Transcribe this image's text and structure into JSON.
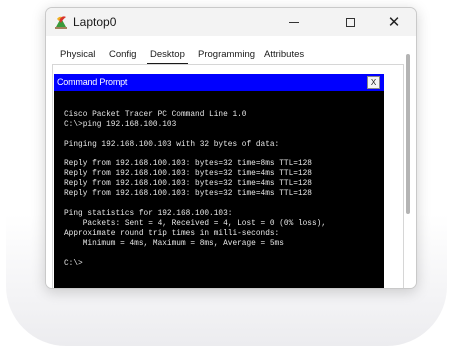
{
  "window": {
    "title": "Laptop0",
    "minimize_glyph": "—",
    "close_glyph": "✕"
  },
  "tabs": [
    {
      "label": "Physical"
    },
    {
      "label": "Config"
    },
    {
      "label": "Desktop",
      "active": true
    },
    {
      "label": "Programming"
    },
    {
      "label": "Attributes"
    }
  ],
  "command_prompt": {
    "title": "Command Prompt",
    "close_label": "X"
  },
  "terminal": {
    "lines": [
      "",
      "Cisco Packet Tracer PC Command Line 1.0",
      "C:\\>ping 192.168.100.103",
      "",
      "Pinging 192.168.100.103 with 32 bytes of data:",
      "",
      "Reply from 192.168.100.103: bytes=32 time=8ms TTL=128",
      "Reply from 192.168.100.103: bytes=32 time=4ms TTL=128",
      "Reply from 192.168.100.103: bytes=32 time=4ms TTL=128",
      "Reply from 192.168.100.103: bytes=32 time=4ms TTL=128",
      "",
      "Ping statistics for 192.168.100.103:",
      "    Packets: Sent = 4, Received = 4, Lost = 0 (0% loss),",
      "Approximate round trip times in milli-seconds:",
      "    Minimum = 4ms, Maximum = 8ms, Average = 5ms",
      "",
      "C:\\>"
    ]
  },
  "colors": {
    "cmd_header": "#0000ff",
    "terminal_bg": "#000000",
    "terminal_fg": "#e6e6e6"
  }
}
